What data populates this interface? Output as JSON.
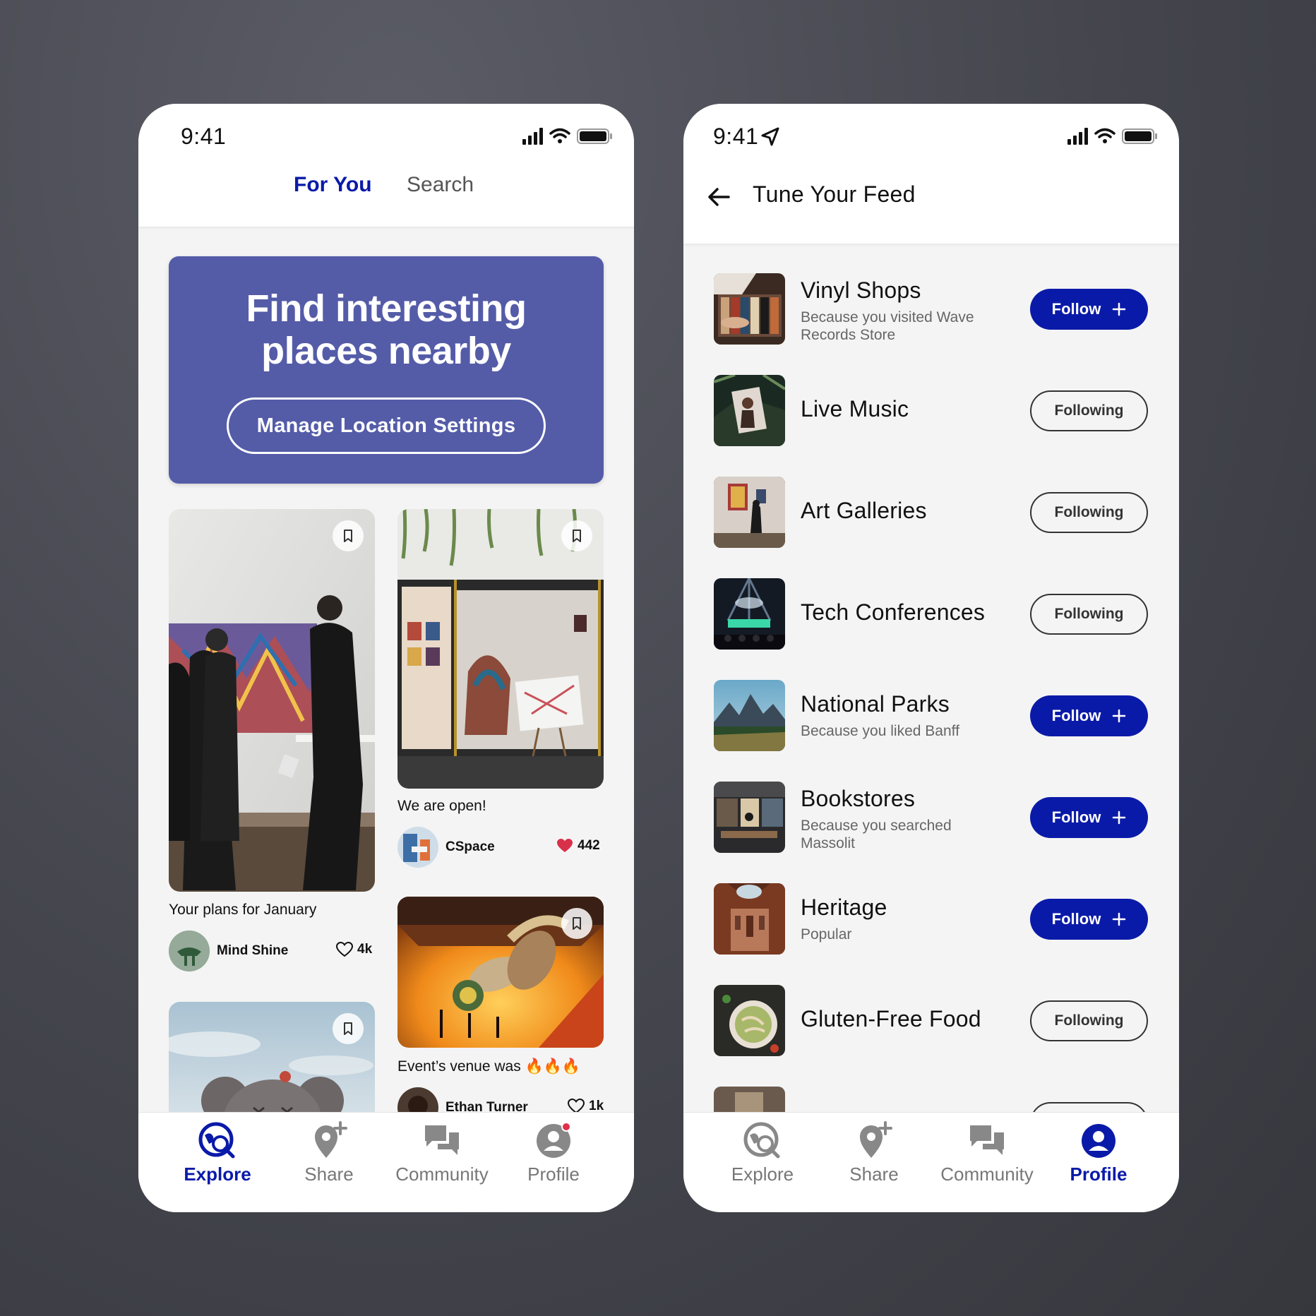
{
  "left_screen": {
    "status_time": "9:41",
    "tabs": [
      {
        "label": "For You",
        "active": true
      },
      {
        "label": "Search",
        "active": false
      }
    ],
    "hero": {
      "title": "Find interesting places nearby",
      "button": "Manage Location Settings",
      "color": "#545ca8"
    },
    "cards": [
      {
        "caption": "Your plans for January",
        "author": "Mind Shine",
        "likes": "4k",
        "liked": false
      },
      {
        "caption": "We are open!",
        "author": "CSpace",
        "likes": "442",
        "liked": true
      },
      {
        "caption": "Event’s venue was 🔥🔥🔥",
        "author": "Ethan Turner",
        "likes": "1k",
        "liked": false
      }
    ],
    "nav": [
      {
        "label": "Explore",
        "icon": "explore-icon",
        "active": true
      },
      {
        "label": "Share",
        "icon": "share-pin-icon",
        "active": false
      },
      {
        "label": "Community",
        "icon": "community-icon",
        "active": false
      },
      {
        "label": "Profile",
        "icon": "profile-icon",
        "active": false,
        "badge": true
      }
    ]
  },
  "right_screen": {
    "status_time": "9:41",
    "title": "Tune Your Feed",
    "items": [
      {
        "title": "Vinyl Shops",
        "subtitle": "Because you visited Wave Records Store",
        "status": "Follow"
      },
      {
        "title": "Live Music",
        "subtitle": "",
        "status": "Following"
      },
      {
        "title": "Art Galleries",
        "subtitle": "",
        "status": "Following"
      },
      {
        "title": "Tech Conferences",
        "subtitle": "",
        "status": "Following"
      },
      {
        "title": "National Parks",
        "subtitle": "Because you liked Banff",
        "status": "Follow"
      },
      {
        "title": "Bookstores",
        "subtitle": "Because you searched Massolit",
        "status": "Follow"
      },
      {
        "title": "Heritage",
        "subtitle": "Popular",
        "status": "Follow"
      },
      {
        "title": "Gluten-Free Food",
        "subtitle": "",
        "status": "Following"
      }
    ],
    "nav": [
      {
        "label": "Explore",
        "icon": "explore-icon",
        "active": false
      },
      {
        "label": "Share",
        "icon": "share-pin-icon",
        "active": false
      },
      {
        "label": "Community",
        "icon": "community-icon",
        "active": false
      },
      {
        "label": "Profile",
        "icon": "profile-icon",
        "active": true
      }
    ]
  },
  "colors": {
    "accent": "#0a1aa8",
    "heart": "#d9304a"
  }
}
